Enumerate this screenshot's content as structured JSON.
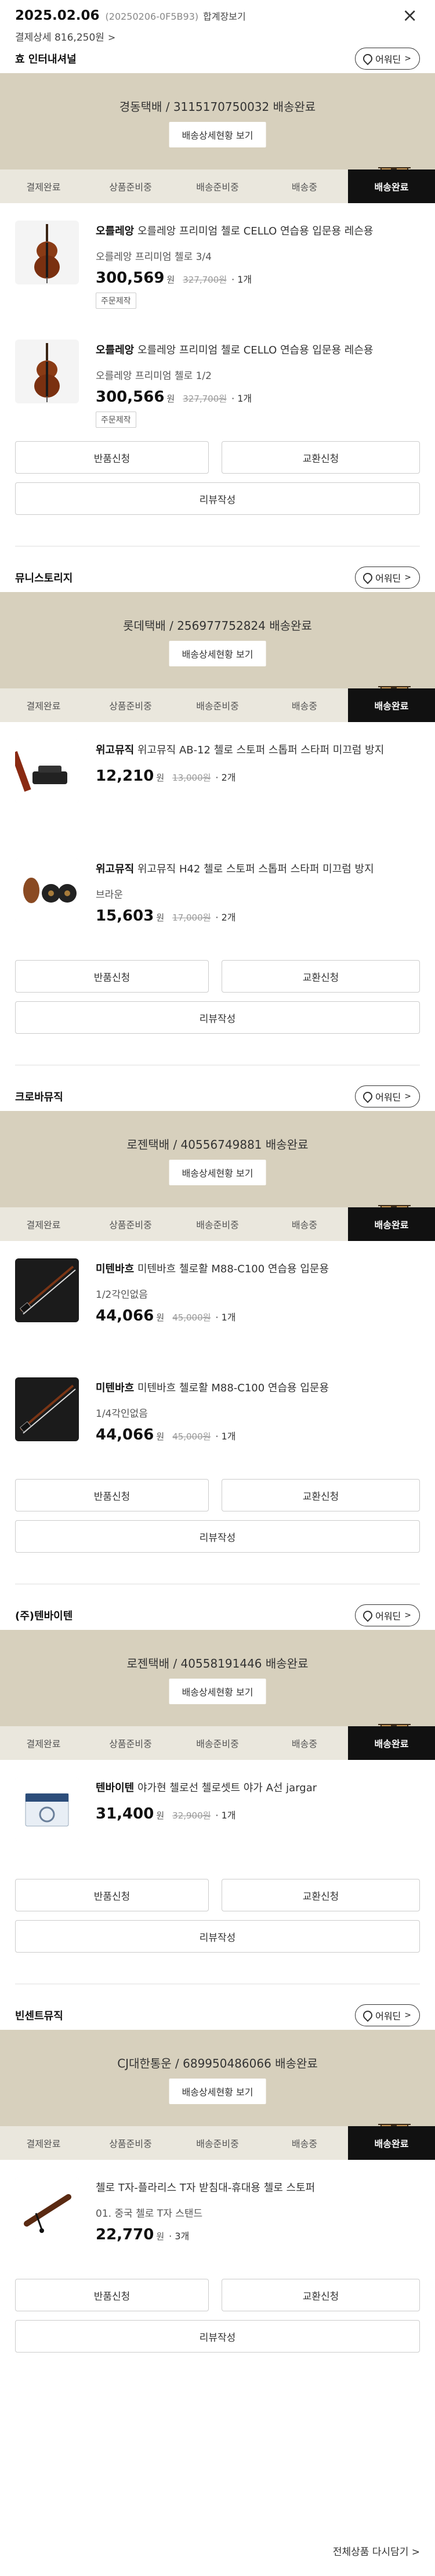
{
  "header": {
    "date": "2025.02.06",
    "order_no": "(20250206-0F5B93)",
    "tag": "합계장보기",
    "total": "결제상세 816,250원",
    "total_chev": ">",
    "close": "×"
  },
  "common": {
    "location_label": "어워딘",
    "location_chev": ">",
    "tracking_button": "배송상세현황 보기",
    "steps": [
      "결제완료",
      "상품준비중",
      "배송준비중",
      "배송중",
      "배송완료"
    ],
    "won": "원",
    "return_btn": "반품신청",
    "exchange_btn": "교환신청",
    "review_btn": "리뷰작성"
  },
  "sellers": [
    {
      "name": "효 인터내셔널",
      "delivery": "경동택배 / 3115170750032 배송완료",
      "items": [
        {
          "brand": "오를레앙",
          "name": "오를레앙 프리미엄 첼로 CELLO 연습용 입문용 레슨용",
          "option": "오를레앙 프리미엄 첼로 3/4",
          "price": "300,569",
          "orig": "327,700원",
          "qty": "· 1개",
          "badge": "주문제작"
        },
        {
          "brand": "오를레앙",
          "name": "오를레앙 프리미엄 첼로 CELLO 연습용 입문용 레슨용",
          "option": "오를레앙 프리미엄 첼로 1/2",
          "price": "300,566",
          "orig": "327,700원",
          "qty": "· 1개",
          "badge": "주문제작"
        }
      ]
    },
    {
      "name": "뮤니스토리지",
      "delivery": "롯데택배 / 256977752824 배송완료",
      "items": [
        {
          "brand": "위고뮤직",
          "name": "위고뮤직 AB-12 첼로 스토퍼 스톱퍼 스타퍼 미끄럼 방지",
          "option": "",
          "price": "12,210",
          "orig": "13,000원",
          "qty": "· 2개",
          "badge": ""
        },
        {
          "brand": "위고뮤직",
          "name": "위고뮤직 H42 첼로 스토퍼 스톱퍼 스타퍼 미끄럼 방지",
          "option": "브라운",
          "price": "15,603",
          "orig": "17,000원",
          "qty": "· 2개",
          "badge": ""
        }
      ]
    },
    {
      "name": "크로바뮤직",
      "delivery": "로젠택배 / 40556749881 배송완료",
      "items": [
        {
          "brand": "미텐바흐",
          "name": "미텐바흐 첼로활 M88-C100 연습용 입문용",
          "option": "1/2각인없음",
          "price": "44,066",
          "orig": "45,000원",
          "qty": "· 1개",
          "badge": ""
        },
        {
          "brand": "미텐바흐",
          "name": "미텐바흐 첼로활 M88-C100 연습용 입문용",
          "option": "1/4각인없음",
          "price": "44,066",
          "orig": "45,000원",
          "qty": "· 1개",
          "badge": ""
        }
      ]
    },
    {
      "name": "(주)텐바이텐",
      "delivery": "로젠택배 / 40558191446 배송완료",
      "items": [
        {
          "brand": "텐바이텐",
          "name": "야가현 첼로선 첼로셋트 야가 A선 jargar",
          "option": "",
          "price": "31,400",
          "orig": "32,900원",
          "qty": "· 1개",
          "badge": ""
        }
      ]
    },
    {
      "name": "빈센트뮤직",
      "delivery": "CJ대한통운 / 689950486066 배송완료",
      "items": [
        {
          "brand": "",
          "name": "첼로 T자-플라리스 T자 받침대-휴대용 첼로 스토퍼",
          "option": "01. 중국 첼로 T자 스탠드",
          "price": "22,770",
          "orig": "",
          "qty": "· 3개",
          "badge": ""
        }
      ]
    }
  ],
  "footer": {
    "more_link": "전체상품 다시담기 >"
  }
}
